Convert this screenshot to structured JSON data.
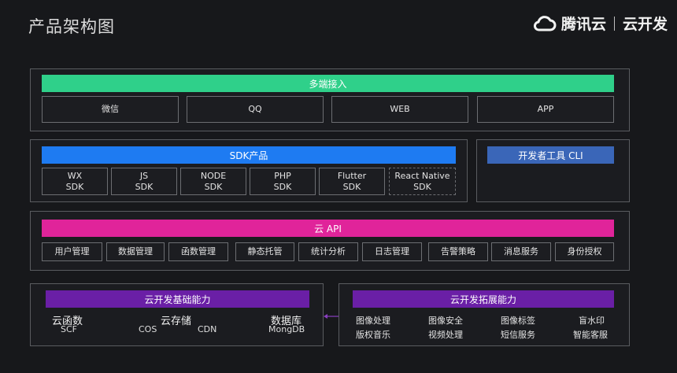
{
  "page_title": "产品架构图",
  "brand": {
    "name": "腾讯云",
    "product": "云开发",
    "icon": "cloud-icon"
  },
  "colors": {
    "green": "#2fd08a",
    "blue": "#1e7bf2",
    "cli_blue": "#3a66b8",
    "magenta": "#e0249a",
    "purple": "#6a1fa6",
    "arrow": "#8a3fc0"
  },
  "multi_access": {
    "header": "多端接入",
    "items": [
      "微信",
      "QQ",
      "WEB",
      "APP"
    ]
  },
  "sdk": {
    "header": "SDK产品",
    "items": [
      {
        "line1": "WX",
        "line2": "SDK"
      },
      {
        "line1": "JS",
        "line2": "SDK"
      },
      {
        "line1": "NODE",
        "line2": "SDK"
      },
      {
        "line1": "PHP",
        "line2": "SDK"
      },
      {
        "line1": "Flutter",
        "line2": "SDK"
      },
      {
        "line1": "React Native",
        "line2": "SDK"
      }
    ]
  },
  "cli": {
    "label": "开发者工具 CLI"
  },
  "cloud_api": {
    "header": "云 API",
    "items": [
      "用户管理",
      "数据管理",
      "函数管理",
      "静态托管",
      "统计分析",
      "日志管理",
      "告警策略",
      "消息服务",
      "身份授权"
    ]
  },
  "basic": {
    "header": "云开发基础能力",
    "groups": [
      {
        "title": "云函数",
        "subs": [
          "SCF"
        ]
      },
      {
        "title": "云存储",
        "subs": [
          "COS",
          "CDN"
        ]
      },
      {
        "title": "数据库",
        "subs": [
          "MongDB"
        ]
      }
    ]
  },
  "extended": {
    "header": "云开发拓展能力",
    "rows": [
      [
        "图像处理",
        "图像安全",
        "图像标签",
        "盲水印"
      ],
      [
        "版权音乐",
        "视频处理",
        "短信服务",
        "智能客服"
      ]
    ]
  }
}
